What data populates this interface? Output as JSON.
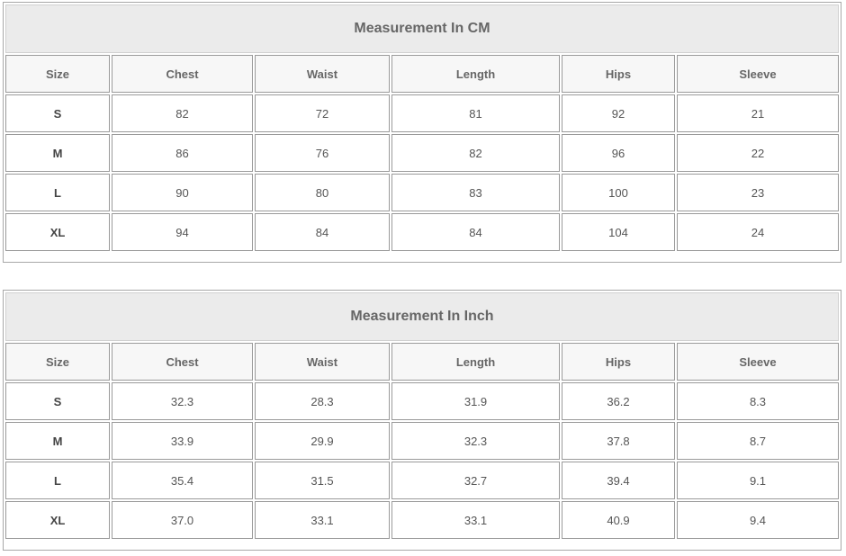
{
  "tables": [
    {
      "title": "Measurement In CM",
      "headers": [
        "Size",
        "Chest",
        "Waist",
        "Length",
        "Hips",
        "Sleeve"
      ],
      "rows": [
        [
          "S",
          "82",
          "72",
          "81",
          "92",
          "21"
        ],
        [
          "M",
          "86",
          "76",
          "82",
          "96",
          "22"
        ],
        [
          "L",
          "90",
          "80",
          "83",
          "100",
          "23"
        ],
        [
          "XL",
          "94",
          "84",
          "84",
          "104",
          "24"
        ]
      ]
    },
    {
      "title": "Measurement In Inch",
      "headers": [
        "Size",
        "Chest",
        "Waist",
        "Length",
        "Hips",
        "Sleeve"
      ],
      "rows": [
        [
          "S",
          "32.3",
          "28.3",
          "31.9",
          "36.2",
          "8.3"
        ],
        [
          "M",
          "33.9",
          "29.9",
          "32.3",
          "37.8",
          "8.7"
        ],
        [
          "L",
          "35.4",
          "31.5",
          "32.7",
          "39.4",
          "9.1"
        ],
        [
          "XL",
          "37.0",
          "33.1",
          "33.1",
          "40.9",
          "9.4"
        ]
      ]
    }
  ]
}
